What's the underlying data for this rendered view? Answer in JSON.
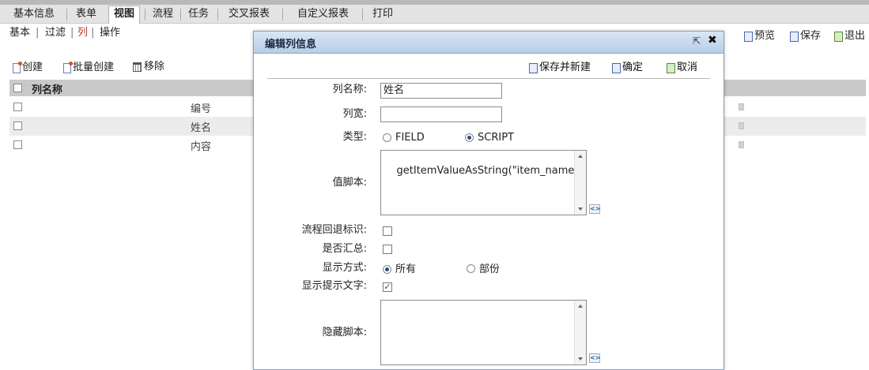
{
  "tabs": [
    {
      "label": "基本信息"
    },
    {
      "label": "表单"
    },
    {
      "label": "视图"
    },
    {
      "label": "流程"
    },
    {
      "label": "任务"
    },
    {
      "label": "交叉报表"
    },
    {
      "label": "自定义报表"
    },
    {
      "label": "打印"
    }
  ],
  "subnav": {
    "basic": "基本",
    "filter": "过滤",
    "column": "列",
    "operation": "操作",
    "sep": "|"
  },
  "toolbar": {
    "create": "创建",
    "batch_create": "批量创建",
    "remove": "移除"
  },
  "right_toolbar": {
    "preview": "预览",
    "save": "保存",
    "exit": "退出"
  },
  "grid": {
    "header": "列名称",
    "rows": [
      {
        "name": "编号"
      },
      {
        "name": "姓名"
      },
      {
        "name": "内容"
      }
    ]
  },
  "dialog": {
    "title": "编辑列信息",
    "save_new": "保存并新建",
    "confirm": "确定",
    "cancel": "取消",
    "fields": {
      "col_name_label": "列名称:",
      "col_name_value": "姓名",
      "col_width_label": "列宽:",
      "col_width_value": "",
      "type_label": "类型:",
      "type_field": "FIELD",
      "type_script": "SCRIPT",
      "value_script_label": "值脚本:",
      "value_script": "getItemValueAsString(\"item_name\");",
      "flow_back_label": "流程回退标识:",
      "summary_label": "是否汇总:",
      "display_mode_label": "显示方式:",
      "display_all": "所有",
      "display_part": "部份",
      "show_hint_label": "显示提示文字:",
      "hide_script_label": "隐藏脚本:",
      "hide_script": ""
    }
  },
  "colors": {
    "accent_red": "#c0392b",
    "title_bg": "#c7d8ee"
  }
}
